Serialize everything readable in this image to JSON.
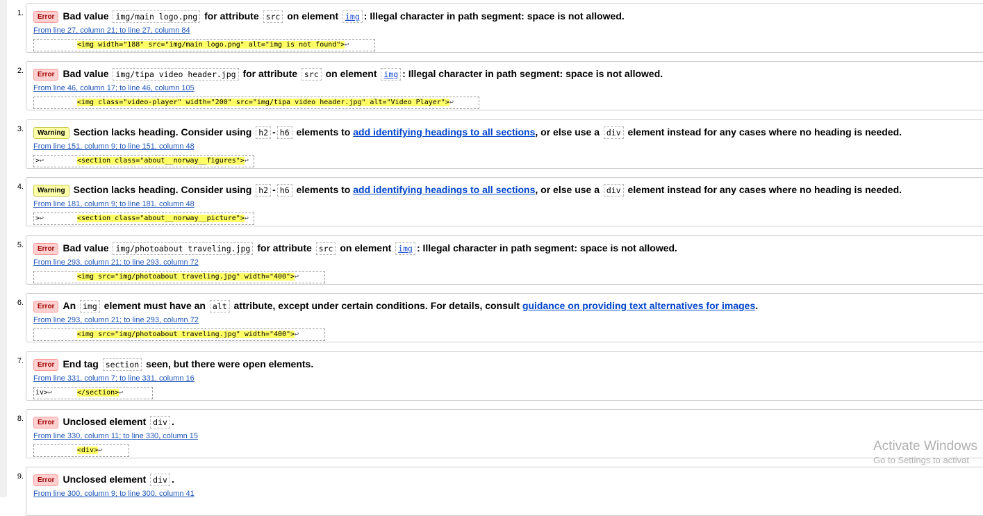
{
  "messages": [
    {
      "number": "1.",
      "type": "Error",
      "parts": [
        {
          "t": "Bad value "
        },
        {
          "t": "img/main logo.png",
          "code": true
        },
        {
          "t": " for attribute "
        },
        {
          "t": "src",
          "code": true
        },
        {
          "t": " on element "
        },
        {
          "t": "img",
          "code": true,
          "link": true
        },
        {
          "t": ": Illegal character in path segment: space is not allowed."
        }
      ],
      "location": "From line 27, column 21; to line 27, column 84",
      "extract_pre": "",
      "extract_mark": "<img width=\"188\" src=\"img/main logo.png\" alt=\"img is not found\">",
      "extract_post": ""
    },
    {
      "number": "2.",
      "type": "Error",
      "parts": [
        {
          "t": "Bad value "
        },
        {
          "t": "img/tipa video header.jpg",
          "code": true
        },
        {
          "t": " for attribute "
        },
        {
          "t": "src",
          "code": true
        },
        {
          "t": " on element "
        },
        {
          "t": "img",
          "code": true,
          "link": true
        },
        {
          "t": ": Illegal character in path segment: space is not allowed."
        }
      ],
      "location": "From line 46, column 17; to line 46, column 105",
      "extract_pre": "",
      "extract_mark": "<img class=\"video-player\" width=\"200\" src=\"img/tipa video header.jpg\" alt=\"Video Player\">",
      "extract_post": ""
    },
    {
      "number": "3.",
      "type": "Warning",
      "parts": [
        {
          "t": "Section lacks heading. Consider using "
        },
        {
          "t": "h2",
          "code": true
        },
        {
          "t": "-"
        },
        {
          "t": "h6",
          "code": true
        },
        {
          "t": " elements to "
        },
        {
          "t": "add identifying headings to all sections",
          "link": true
        },
        {
          "t": ", or else use a "
        },
        {
          "t": "div",
          "code": true
        },
        {
          "t": " element instead for any cases where no heading is needed."
        }
      ],
      "location": "From line 151, column 9; to line 151, column 48",
      "extract_pre": ">",
      "extract_mark": "<section class=\"about__norway__figures\">",
      "extract_post": ""
    },
    {
      "number": "4.",
      "type": "Warning",
      "parts": [
        {
          "t": "Section lacks heading. Consider using "
        },
        {
          "t": "h2",
          "code": true
        },
        {
          "t": "-"
        },
        {
          "t": "h6",
          "code": true
        },
        {
          "t": " elements to "
        },
        {
          "t": "add identifying headings to all sections",
          "link": true
        },
        {
          "t": ", or else use a "
        },
        {
          "t": "div",
          "code": true
        },
        {
          "t": " element instead for any cases where no heading is needed."
        }
      ],
      "location": "From line 181, column 9; to line 181, column 48",
      "extract_pre": ">",
      "extract_mark": "<section class=\"about__norway__picture\">",
      "extract_post": ""
    },
    {
      "number": "5.",
      "type": "Error",
      "parts": [
        {
          "t": "Bad value "
        },
        {
          "t": "img/photoabout traveling.jpg",
          "code": true
        },
        {
          "t": " for attribute "
        },
        {
          "t": "src",
          "code": true
        },
        {
          "t": " on element "
        },
        {
          "t": "img",
          "code": true,
          "link": true
        },
        {
          "t": ": Illegal character in path segment: space is not allowed."
        }
      ],
      "location": "From line 293, column 21; to line 293, column 72",
      "extract_pre": "",
      "extract_mark": "<img src=\"img/photoabout traveling.jpg\" width=\"400\">",
      "extract_post": ""
    },
    {
      "number": "6.",
      "type": "Error",
      "parts": [
        {
          "t": "An "
        },
        {
          "t": "img",
          "code": true
        },
        {
          "t": " element must have an "
        },
        {
          "t": "alt",
          "code": true
        },
        {
          "t": " attribute, except under certain conditions. For details, consult "
        },
        {
          "t": "guidance on providing text alternatives for images",
          "link": true
        },
        {
          "t": "."
        }
      ],
      "location": "From line 293, column 21; to line 293, column 72",
      "extract_pre": "",
      "extract_mark": "<img src=\"img/photoabout traveling.jpg\" width=\"400\">",
      "extract_post": ""
    },
    {
      "number": "7.",
      "type": "Error",
      "parts": [
        {
          "t": "End tag "
        },
        {
          "t": "section",
          "code": true
        },
        {
          "t": " seen, but there were open elements."
        }
      ],
      "location": "From line 331, column 7; to line 331, column 16",
      "extract_pre": "iv>",
      "extract_mark": "</section>",
      "extract_post": ""
    },
    {
      "number": "8.",
      "type": "Error",
      "parts": [
        {
          "t": "Unclosed element "
        },
        {
          "t": "div",
          "code": true
        },
        {
          "t": "."
        }
      ],
      "location": "From line 330, column 11; to line 330, column 15",
      "extract_pre": "",
      "extract_mark": "<div>",
      "extract_post": ""
    },
    {
      "number": "9.",
      "type": "Error",
      "parts": [
        {
          "t": "Unclosed element "
        },
        {
          "t": "div",
          "code": true
        },
        {
          "t": "."
        }
      ],
      "location": "From line 300, column 9; to line 300, column 41",
      "extract_pre": "",
      "extract_mark": "",
      "extract_post": ""
    }
  ],
  "return_glyph": "↩",
  "watermark": {
    "line1": "Activate Windows",
    "line2": "Go to Settings to activat"
  },
  "colors": {
    "error_badge_bg": "#ffd0d0",
    "warning_badge_bg": "#ffffa8",
    "extract_highlight": "#ffff66",
    "link": "#0044cc"
  }
}
